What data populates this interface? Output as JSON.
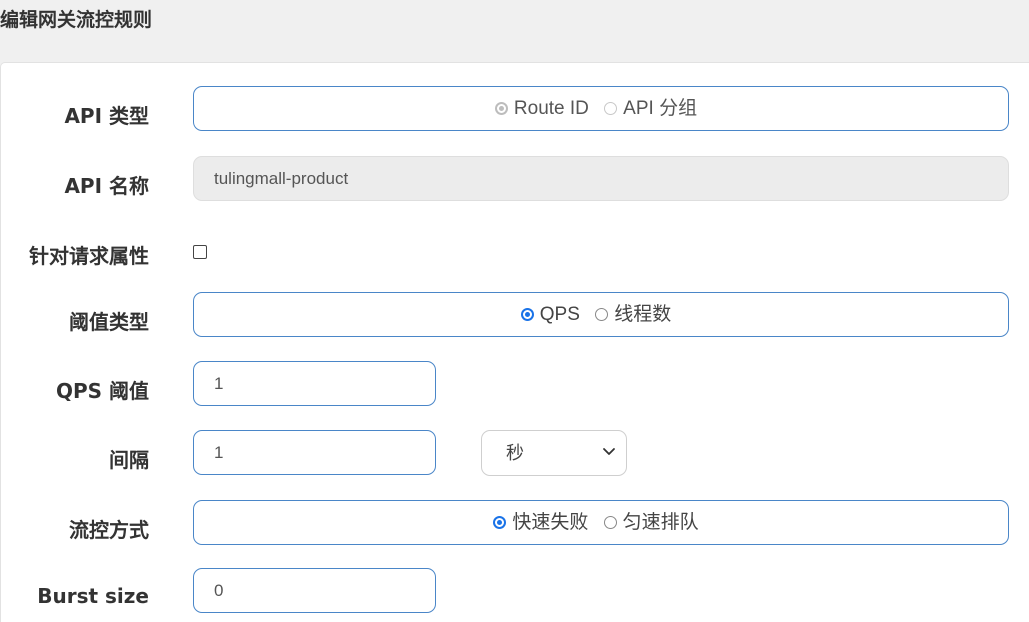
{
  "dialog": {
    "title": "编辑网关流控规则"
  },
  "form": {
    "api_type": {
      "label": "API 类型",
      "options": [
        "Route ID",
        "API 分组"
      ],
      "selected": "Route ID",
      "disabled": true
    },
    "api_name": {
      "label": "API 名称",
      "value": "tulingmall-product"
    },
    "param_flow": {
      "label": "针对请求属性",
      "checked": false
    },
    "threshold_type": {
      "label": "阈值类型",
      "options": [
        "QPS",
        "线程数"
      ],
      "selected": "QPS"
    },
    "qps_threshold": {
      "label": "QPS 阈值",
      "value": "1"
    },
    "interval": {
      "label": "间隔",
      "value": "1",
      "unit": "秒"
    },
    "control_behavior": {
      "label": "流控方式",
      "options": [
        "快速失败",
        "匀速排队"
      ],
      "selected": "快速失败"
    },
    "burst_size": {
      "label": "Burst size",
      "value": "0"
    }
  },
  "colors": {
    "accent": "#1a73e8",
    "border": "#4a86c8",
    "header_bg": "#f0f0f0"
  },
  "icons": {
    "select_arrow": "chevron-down-icon"
  }
}
